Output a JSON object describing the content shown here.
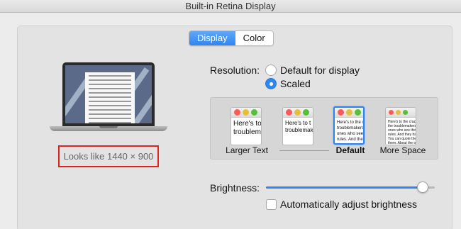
{
  "window": {
    "title": "Built-in Retina Display"
  },
  "tabs": [
    {
      "label": "Display",
      "active": true
    },
    {
      "label": "Color",
      "active": false
    }
  ],
  "preview": {
    "looks_like": "Looks like 1440 × 900"
  },
  "resolution": {
    "label": "Resolution:",
    "options": [
      {
        "label": "Default for display",
        "selected": false
      },
      {
        "label": "Scaled",
        "selected": true
      }
    ]
  },
  "scaling": {
    "options": [
      {
        "label": "Larger Text",
        "text": "Here's to\ntroublem",
        "selected": false
      },
      {
        "label": "",
        "text": "Here's to t\ntroublemake",
        "selected": false
      },
      {
        "label": "Default",
        "text": "Here's to the cr\ntroublemakers.\nones who see t\nrules. And they",
        "selected": true
      },
      {
        "label": "More Space",
        "text": "Here's to the crazy ones\nthe troublemakers. The\nones who see things diff\nrules. And they have no\nYou can quote them, dis\nthem. About the only th\nBecause they change th",
        "selected": false
      }
    ]
  },
  "brightness": {
    "label": "Brightness:",
    "value": 0.93
  },
  "auto_brightness": {
    "label": "Automatically adjust brightness",
    "checked": false
  },
  "colors": {
    "accent": "#2f86f0",
    "highlight": "#e0231b"
  }
}
